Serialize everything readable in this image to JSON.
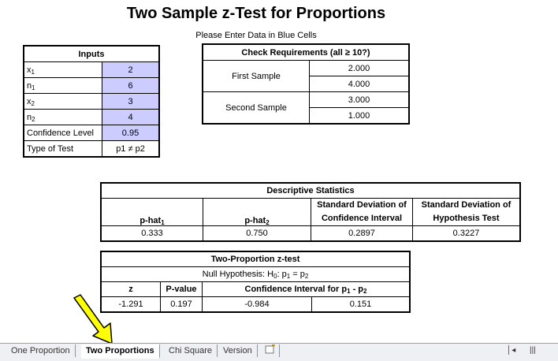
{
  "title": "Two Sample z-Test for Proportions",
  "subtitle": "Please Enter Data in Blue Cells",
  "inputs": {
    "header": "Inputs",
    "x1_label": "x",
    "x1_sub": "1",
    "x1_value": "2",
    "n1_label": "n",
    "n1_sub": "1",
    "n1_value": "6",
    "x2_label": "x",
    "x2_sub": "2",
    "x2_value": "3",
    "n2_label": "n",
    "n2_sub": "2",
    "n2_value": "4",
    "conf_label": "Confidence Level",
    "conf_value": "0.95",
    "test_label": "Type of Test",
    "test_value": "p1 ≠ p2"
  },
  "check": {
    "header": "Check Requirements (all ≥ 10?)",
    "first_label": "First Sample",
    "first_values": [
      "2.000",
      "4.000"
    ],
    "second_label": "Second Sample",
    "second_values": [
      "3.000",
      "1.000"
    ]
  },
  "descriptive": {
    "header": "Descriptive Statistics",
    "col1": "p-hat",
    "col1_sub": "1",
    "col2": "p-hat",
    "col2_sub": "2",
    "col3_line1": "Standard Deviation of",
    "col3_line2": "Confidence Interval",
    "col4_line1": "Standard Deviation of",
    "col4_line2": "Hypothesis Test",
    "values": [
      "0.333",
      "0.750",
      "0.2897",
      "0.3227"
    ]
  },
  "ztest": {
    "header": "Two-Proportion z-test",
    "null_prefix": "Null Hypothesis:  H",
    "null_h_sub": "0",
    "null_p": ": p",
    "null_p1_sub": "1",
    "null_eq": " = p",
    "null_p2_sub": "2",
    "z_label": "z",
    "pvalue_label": "P-value",
    "ci_label": "Confidence Interval  for p",
    "ci_sub1": "1",
    "ci_mid": " - p",
    "ci_sub2": "2",
    "z_value": "-1.291",
    "pvalue": "0.197",
    "ci_low": "-0.984",
    "ci_high": "0.151"
  },
  "tabs": [
    "One Proportion",
    "Two Proportions",
    "Chi Square",
    "Version"
  ],
  "colors": {
    "input_blue": "#ccccff",
    "arrow_yellow": "#ffff00"
  }
}
